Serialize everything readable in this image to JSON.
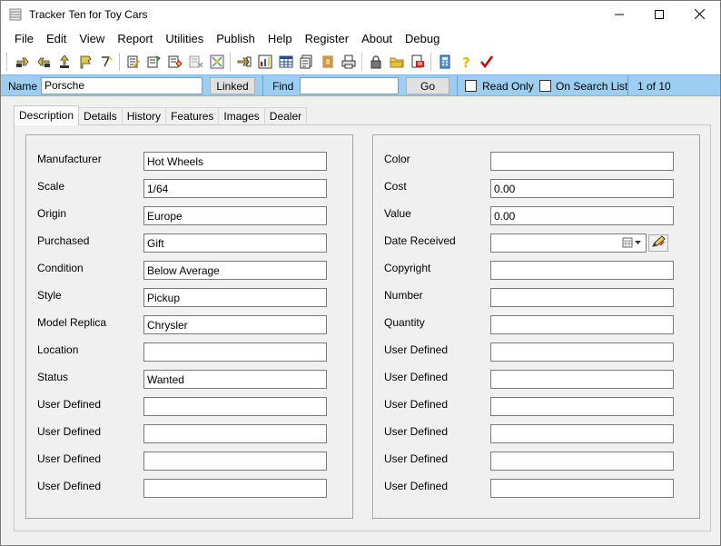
{
  "window": {
    "title": "Tracker Ten for Toy Cars",
    "controls": {
      "minimize_icon": "minimize-icon",
      "maximize_icon": "maximize-icon",
      "close_icon": "close-icon"
    }
  },
  "menu": [
    "File",
    "Edit",
    "View",
    "Report",
    "Utilities",
    "Publish",
    "Help",
    "Register",
    "About",
    "Debug"
  ],
  "toolbar": {
    "icons": [
      "first-record-icon",
      "previous-record-icon",
      "upload-icon",
      "bookmark-icon",
      "sort-icon",
      "edit-record-icon",
      "copy-record-icon",
      "add-record-icon",
      "delete-record-icon",
      "move-record-icon",
      "goto-icon",
      "chart-icon",
      "table-view-icon",
      "export-icon",
      "stamp-icon",
      "print-icon",
      "lock-icon",
      "folder-icon",
      "pdf-icon",
      "calculator-icon",
      "help-icon",
      "checkmark-icon"
    ]
  },
  "searchbar": {
    "name_label": "Name",
    "name_value": "Porsche",
    "linked_label": "Linked",
    "find_label": "Find",
    "find_value": "",
    "go_label": "Go",
    "read_only_label": "Read Only",
    "on_search_list_label": "On Search List",
    "record_position": "1 of 10"
  },
  "tabs": [
    "Description",
    "Details",
    "History",
    "Features",
    "Images",
    "Dealer"
  ],
  "active_tab": "Description",
  "left_fields": [
    {
      "label": "Manufacturer",
      "value": "Hot Wheels"
    },
    {
      "label": "Scale",
      "value": "1/64"
    },
    {
      "label": "Origin",
      "value": "Europe"
    },
    {
      "label": "Purchased",
      "value": "Gift"
    },
    {
      "label": "Condition",
      "value": "Below Average"
    },
    {
      "label": "Style",
      "value": "Pickup"
    },
    {
      "label": "Model Replica",
      "value": "Chrysler"
    },
    {
      "label": "Location",
      "value": ""
    },
    {
      "label": "Status",
      "value": "Wanted"
    },
    {
      "label": "User Defined",
      "value": ""
    },
    {
      "label": "User Defined",
      "value": ""
    },
    {
      "label": "User Defined",
      "value": ""
    },
    {
      "label": "User Defined",
      "value": ""
    }
  ],
  "right_fields": [
    {
      "label": "Color",
      "value": ""
    },
    {
      "label": "Cost",
      "value": "0.00"
    },
    {
      "label": "Value",
      "value": "0.00"
    },
    {
      "label": "Date Received",
      "value": ""
    },
    {
      "label": "Copyright",
      "value": ""
    },
    {
      "label": "Number",
      "value": ""
    },
    {
      "label": "Quantity",
      "value": ""
    },
    {
      "label": "User Defined",
      "value": ""
    },
    {
      "label": "User Defined",
      "value": ""
    },
    {
      "label": "User Defined",
      "value": ""
    },
    {
      "label": "User Defined",
      "value": ""
    },
    {
      "label": "User Defined",
      "value": ""
    },
    {
      "label": "User Defined",
      "value": ""
    }
  ],
  "colors": {
    "searchbar_bg": "#9ccef2",
    "window_bg": "#f0f0f0",
    "accent_red": "#d40000"
  }
}
